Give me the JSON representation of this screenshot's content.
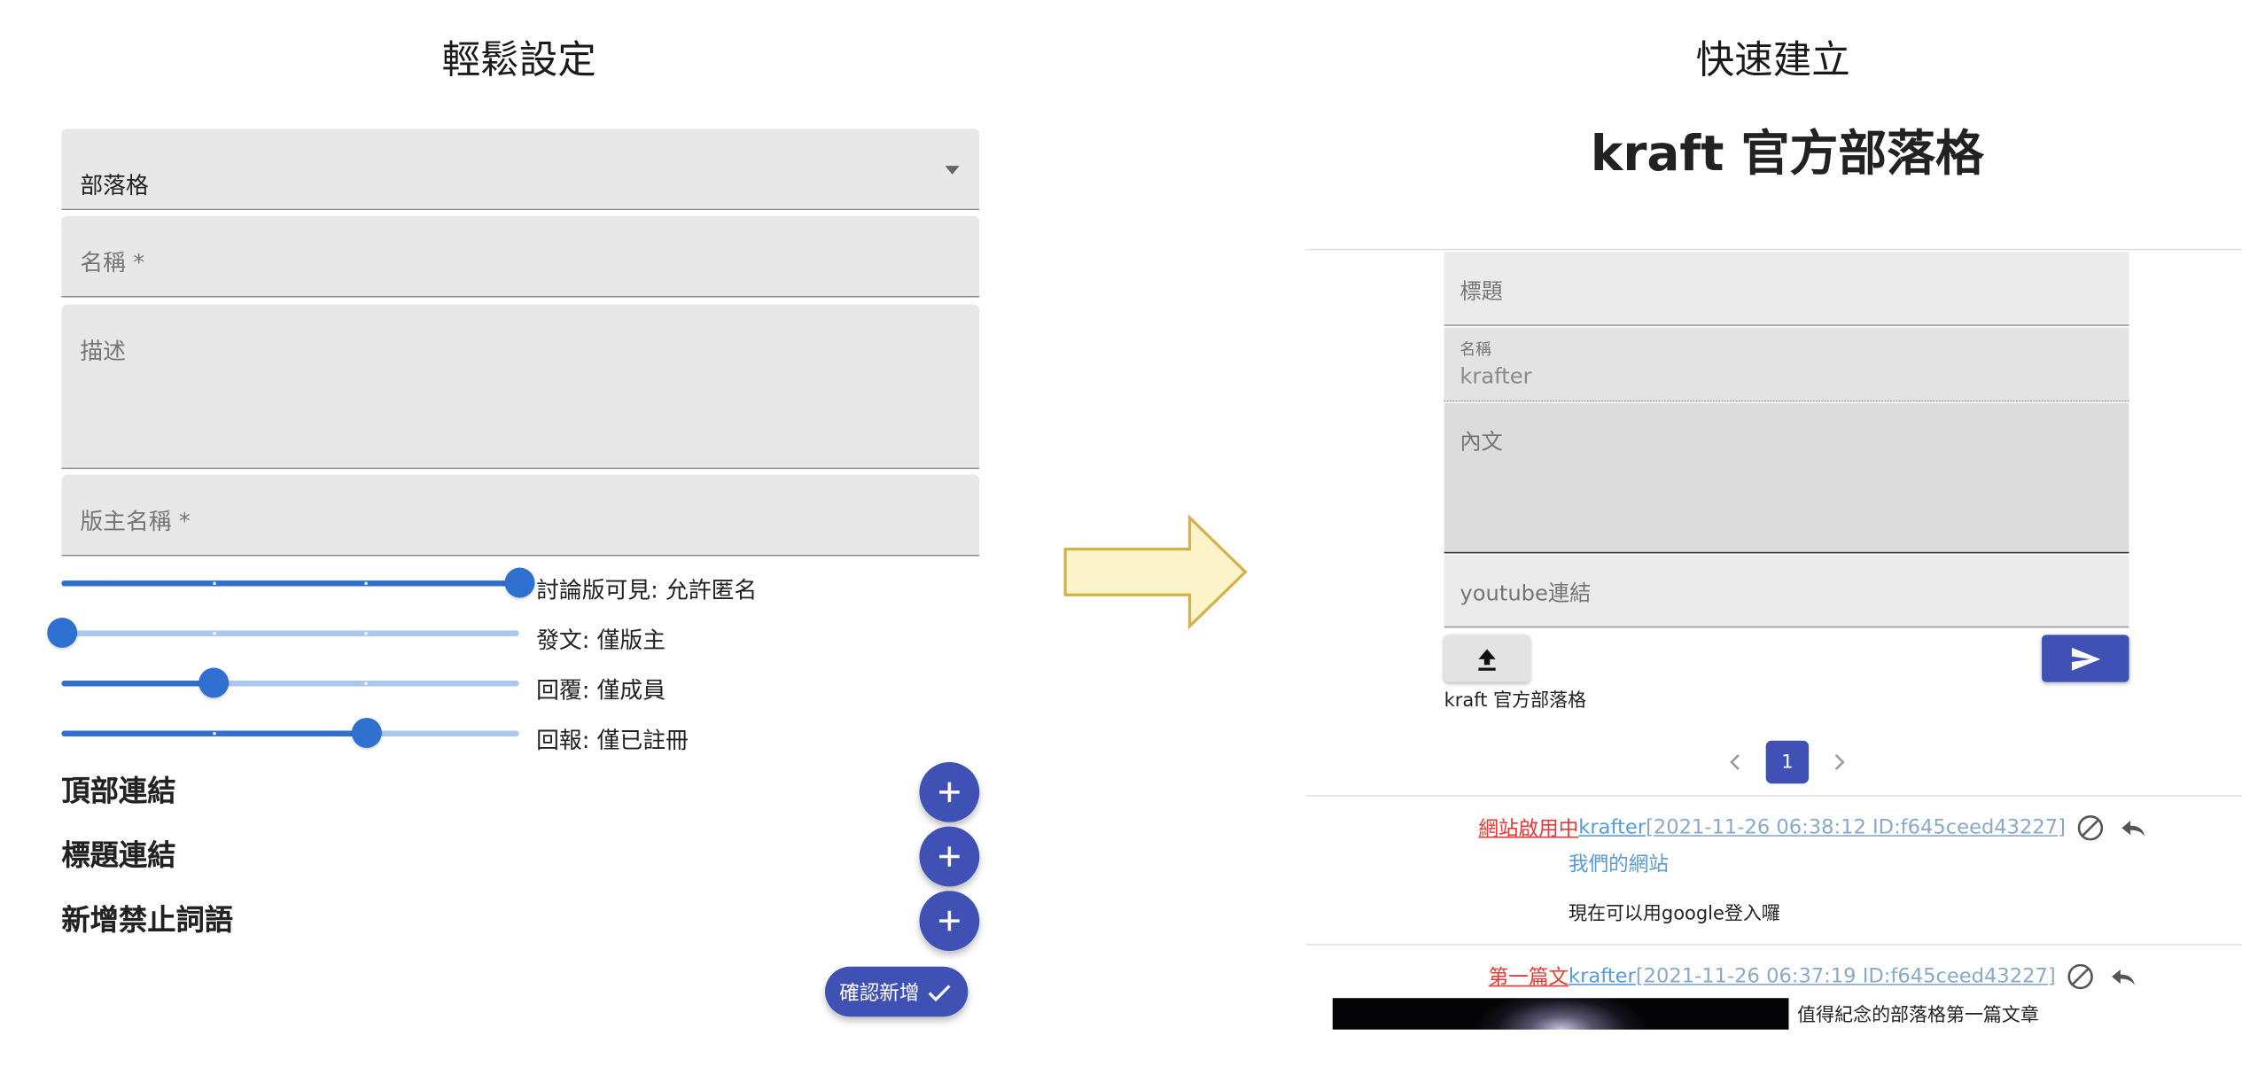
{
  "left": {
    "title": "輕鬆設定",
    "type_select": {
      "value": "部落格"
    },
    "name_field": {
      "label": "名稱 *"
    },
    "desc_field": {
      "label": "描述"
    },
    "owner_field": {
      "label": "版主名稱 *"
    },
    "sliders": [
      {
        "label": "討論版可見: 允許匿名",
        "level": 1.0
      },
      {
        "label": "發文: 僅版主",
        "level": 0.0
      },
      {
        "label": "回覆: 僅成員",
        "level": 0.333
      },
      {
        "label": "回報: 僅已註冊",
        "level": 0.667
      }
    ],
    "sections": [
      "頂部連結",
      "標題連結",
      "新增禁止詞語"
    ],
    "confirm_label": "確認新增"
  },
  "arrow": {
    "color": "#fdf3c8",
    "stroke": "#d4b24a"
  },
  "right": {
    "title": "快速建立",
    "blog_title": "kraft 官方部落格",
    "form": {
      "title_label": "標題",
      "name_label": "名稱",
      "name_value": "krafter",
      "content_label": "內文",
      "youtube_label": "youtube連結"
    },
    "board_name": "kraft 官方部落格",
    "pagination": {
      "current": "1"
    },
    "posts": [
      {
        "tag": "網站啟用中",
        "author": "krafter",
        "meta": "[2021-11-26 06:38:12 ID:f645ceed43227]",
        "link_text": "我們的網站",
        "body": "現在可以用google登入囉"
      },
      {
        "tag": "第一篇文",
        "author": "krafter",
        "meta": "[2021-11-26 06:37:19 ID:f645ceed43227]",
        "body": "值得紀念的部落格第一篇文章"
      }
    ]
  },
  "colors": {
    "primary": "#3f51b5",
    "slider": "#2e6fd0",
    "tag_red": "#e53935",
    "link_blue": "#5b9bd5"
  }
}
